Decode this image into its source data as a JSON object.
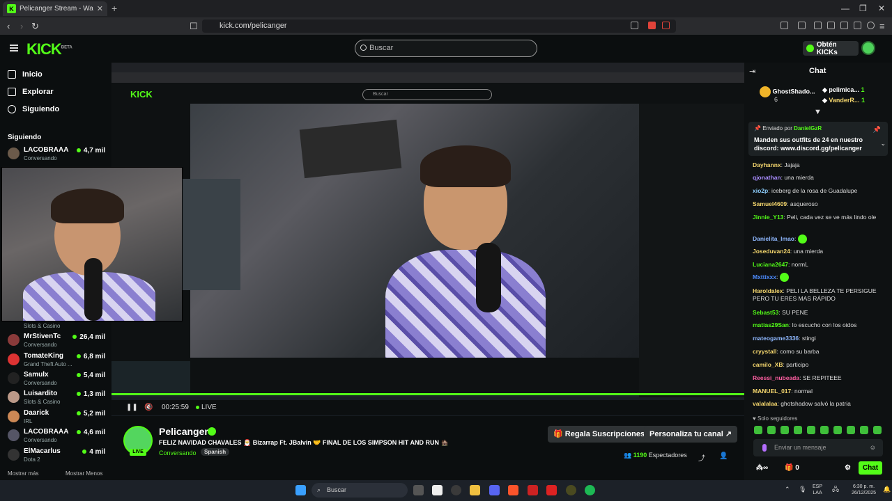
{
  "browser": {
    "tab_title": "Pelicanger Stream - Watch Li...",
    "url": "kick.com/pelicanger"
  },
  "header": {
    "search_placeholder": "Buscar",
    "kicks_button": "Obtén KICKs",
    "logo": "KICK",
    "logo_beta": "BETA"
  },
  "sidebar": {
    "nav": [
      {
        "label": "Inicio",
        "icon": "home-icon"
      },
      {
        "label": "Explorar",
        "icon": "compass-icon"
      },
      {
        "label": "Siguiendo",
        "icon": "heart-icon"
      }
    ],
    "following_title": "Siguiendo",
    "following": [
      {
        "name": "LACOBRAAA",
        "category": "Conversando",
        "viewers": "4,7 mil"
      },
      {
        "name": "MrStivenTc",
        "category": "Conversando",
        "viewers": "26,4 mil"
      },
      {
        "name": "TomateKing",
        "category": "Grand Theft Auto ...",
        "viewers": "6,8 mil"
      },
      {
        "name": "Samulx",
        "category": "Conversando",
        "viewers": "5,4 mil"
      },
      {
        "name": "Luisardito",
        "category": "Slots & Casino",
        "viewers": "1,3 mil"
      },
      {
        "name": "Daarick",
        "category": "IRL",
        "viewers": "5,2 mil"
      },
      {
        "name": "LACOBRAAA",
        "category": "Conversando",
        "viewers": "4,6 mil"
      },
      {
        "name": "ElMacarlus",
        "category": "Dota 2",
        "viewers": "4 mil"
      }
    ],
    "partial_category": "Slots & Casino",
    "show_more": "Mostrar más",
    "show_less": "Mostrar Menos"
  },
  "player": {
    "time": "00:25:59",
    "live": "LIVE"
  },
  "stream": {
    "streamer": "Pelicanger",
    "title": "FELIZ NAVIDAD CHAVALES 🎅 Bizarrap Ft. JBalvin 🤝 FINAL DE LOS SIMPSON HIT AND RUN 🏚️",
    "category": "Conversando",
    "language": "Spanish",
    "gift_button": "Regala Suscripciones",
    "customize_button": "Personaliza tu canal",
    "viewers_count": "1190",
    "viewers_label": "Espectadores",
    "live_badge": "LIVE"
  },
  "chat": {
    "title": "Chat",
    "leaderboard": [
      {
        "name": "GhostShado...",
        "count": "6"
      },
      {
        "name": "pelimica...",
        "count": "1"
      },
      {
        "name": "VanderR...",
        "count": "1"
      }
    ],
    "pinned_by_label": "Enviado por",
    "pinned_by_user": "DanielGzR",
    "pinned_message": "Manden sus outfits de 24 en nuestro discord: www.discord.gg/pelicanger",
    "messages": [
      {
        "user": "Dayhannx",
        "color": "#f5d76e",
        "text": "Jajaja"
      },
      {
        "user": "qjonathan",
        "color": "#a98cff",
        "text": "una mierda"
      },
      {
        "user": "xio2p",
        "color": "#8fd0ff",
        "text": "iceberg de la rosa de Guadalupe"
      },
      {
        "user": "Samuel4609",
        "color": "#f5d76e",
        "text": "asqueroso"
      },
      {
        "user": "Jinnie_Y13",
        "color": "#53fc18",
        "text": "Peli, cada vez se ve más lindo ole"
      },
      {
        "user": "Danielita_lmao",
        "color": "#8fb8ff",
        "text": ""
      },
      {
        "user": "Joseduvan24",
        "color": "#f5d76e",
        "text": "una mierda"
      },
      {
        "user": "Luciana2647",
        "color": "#53fc18",
        "text": "normL"
      },
      {
        "user": "Mxttixxx",
        "color": "#4d8cff",
        "text": ""
      },
      {
        "user": "Haroldalex",
        "color": "#f5d76e",
        "text": "PELI LA BELLEZA TE PERSIGUE PERO TU ERES MAS RÁPIDO"
      },
      {
        "user": "Sebast53",
        "color": "#53fc18",
        "text": "SU PENE"
      },
      {
        "user": "matias29San",
        "color": "#53fc18",
        "text": "lo escucho con los oidos"
      },
      {
        "user": "mateogame3336",
        "color": "#8fb8ff",
        "text": "stingi"
      },
      {
        "user": "cryystall",
        "color": "#f5d76e",
        "text": "como su barba"
      },
      {
        "user": "camilo_XB",
        "color": "#f5d76e",
        "text": "participo"
      },
      {
        "user": "Reessi_nubeada",
        "color": "#ff5fa2",
        "text": "SE REPITEEE"
      },
      {
        "user": "MANUEL_017",
        "color": "#f5d76e",
        "text": "normal"
      },
      {
        "user": "valalalaa",
        "color": "#f5d76e",
        "text": "ghotshadow salvó la patria"
      }
    ],
    "followers_only": "Solo seguidores",
    "input_placeholder": "Enviar un mensaje",
    "send_label": "Chat",
    "points": "0"
  },
  "taskbar": {
    "search": "Buscar",
    "lang_top": "ESP",
    "lang_bottom": "LAA",
    "time": "6:30 p. m.",
    "date": "26/12/2025"
  },
  "colors": {
    "accent": "#53fc18",
    "background": "#0b0e0f",
    "chat_bg": "#0e1112"
  }
}
